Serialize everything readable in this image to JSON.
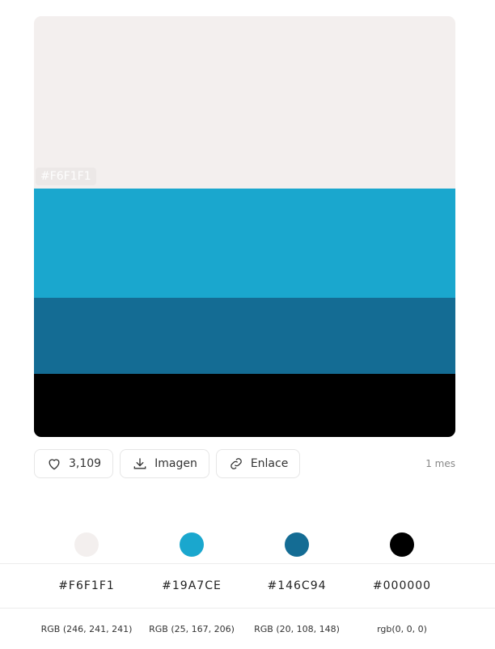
{
  "palette": {
    "swatches": [
      {
        "hex": "#F6F1F1",
        "color": "#F3EFEE",
        "label": "#F6F1F1"
      },
      {
        "hex": "#19A7CE",
        "color": "#1AA7CE"
      },
      {
        "hex": "#146C94",
        "color": "#146C94"
      },
      {
        "hex": "#000000",
        "color": "#000000"
      }
    ]
  },
  "actions": {
    "like_count": "3,109",
    "image_label": "Imagen",
    "link_label": "Enlace",
    "time_ago": "1 mes"
  },
  "colors": [
    {
      "hex": "#F6F1F1",
      "rgb": "RGB (246, 241, 241)",
      "color": "#F3EFEE"
    },
    {
      "hex": "#19A7CE",
      "rgb": "RGB (25, 167, 206)",
      "color": "#1AA7CE"
    },
    {
      "hex": "#146C94",
      "rgb": "RGB (20, 108, 148)",
      "color": "#146C94"
    },
    {
      "hex": "#000000",
      "rgb": "rgb(0, 0, 0)",
      "color": "#000000"
    }
  ]
}
